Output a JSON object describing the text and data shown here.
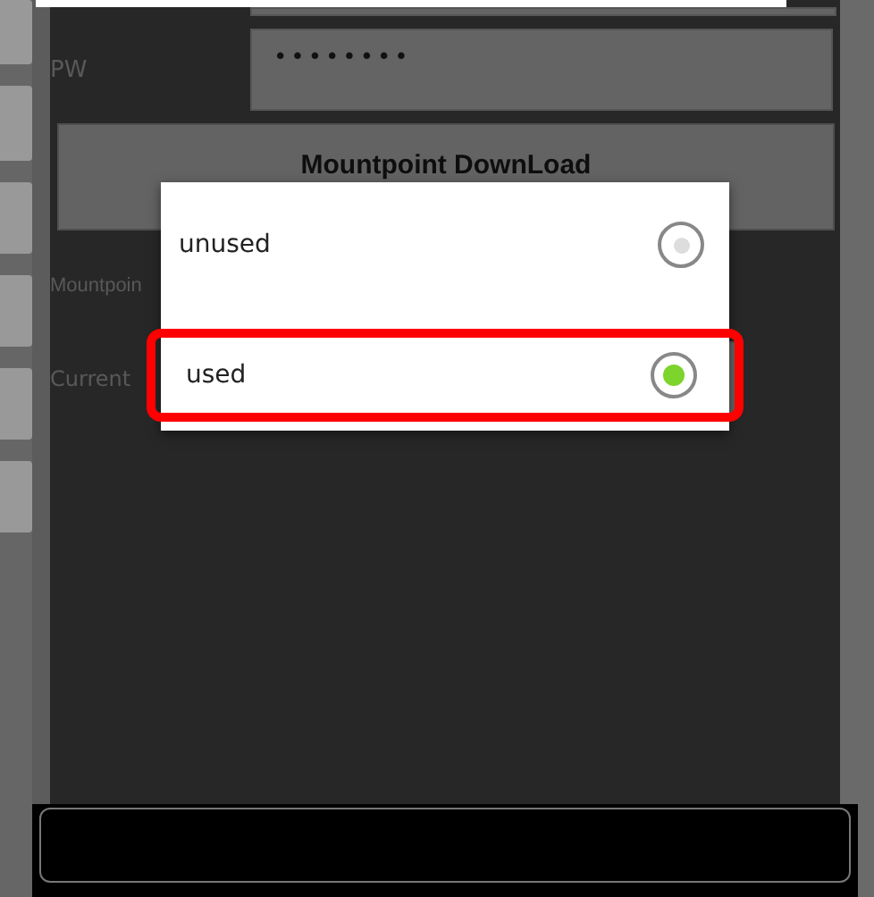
{
  "form": {
    "password_label": "PW",
    "password_value": "••••••••",
    "download_button": "Mountpoint DownLoad",
    "mountpoint_label": "Mountpoin",
    "current_label": "Current"
  },
  "dialog": {
    "options": [
      {
        "label": "unused",
        "selected": false,
        "highlighted": false
      },
      {
        "label": "used",
        "selected": true,
        "highlighted": true
      }
    ]
  }
}
